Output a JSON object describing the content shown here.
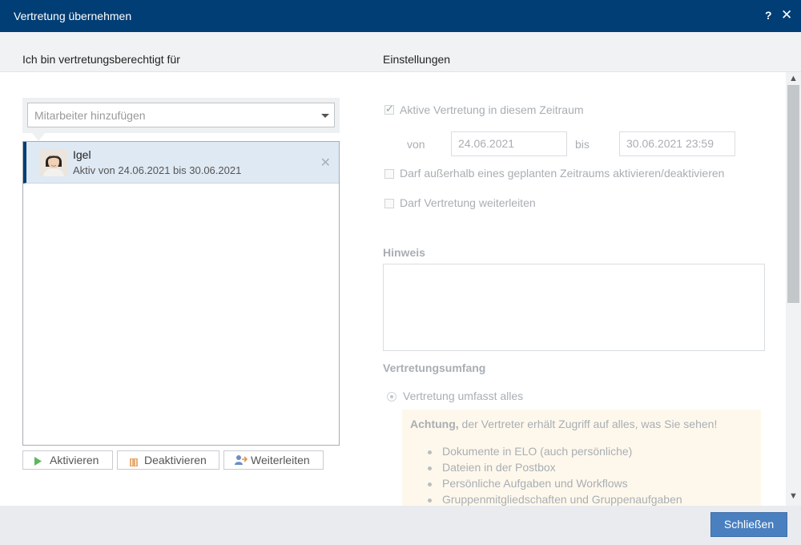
{
  "dialog": {
    "title": "Vertretung übernehmen",
    "help_label": "?",
    "close_label": "✕"
  },
  "left_panel": {
    "heading": "Ich bin vertretungsberechtigt für",
    "combo_placeholder": "Mitarbeiter hinzufügen",
    "users": [
      {
        "name": "Igel",
        "subtitle": "Aktiv von 24.06.2021 bis 30.06.2021",
        "selected": true
      }
    ],
    "buttons": {
      "activate": "Aktivieren",
      "deactivate": "Deaktivieren",
      "forward": "Weiterleiten"
    }
  },
  "right_panel": {
    "heading": "Einstellungen",
    "active_checkbox": {
      "label": "Aktive Vertretung in diesem Zeitraum",
      "checked": true
    },
    "from_label": "von",
    "from_value": "24.06.2021",
    "to_label": "bis",
    "to_value": "30.06.2021 23:59",
    "outside_checkbox": {
      "label": "Darf außerhalb eines geplanten Zeitraums aktivieren/deaktivieren",
      "checked": false
    },
    "forward_checkbox": {
      "label": "Darf Vertretung weiterleiten",
      "checked": false
    },
    "note_heading": "Hinweis",
    "scope_heading": "Vertretungsumfang",
    "scope_option": "Vertretung umfasst alles",
    "warning_bold": "Achtung,",
    "warning_text": " der Vertreter erhält Zugriff auf alles, was Sie sehen!",
    "warning_items": [
      "Dokumente in ELO (auch persönliche)",
      "Dateien in der Postbox",
      "Persönliche Aufgaben und Workflows",
      "Gruppenmitgliedschaften und Gruppenaufgaben"
    ]
  },
  "footer": {
    "close_button": "Schließen"
  },
  "colors": {
    "titlebar": "#003e75",
    "primary_button": "#4a80c0",
    "warning_bg": "#fef8ec"
  }
}
